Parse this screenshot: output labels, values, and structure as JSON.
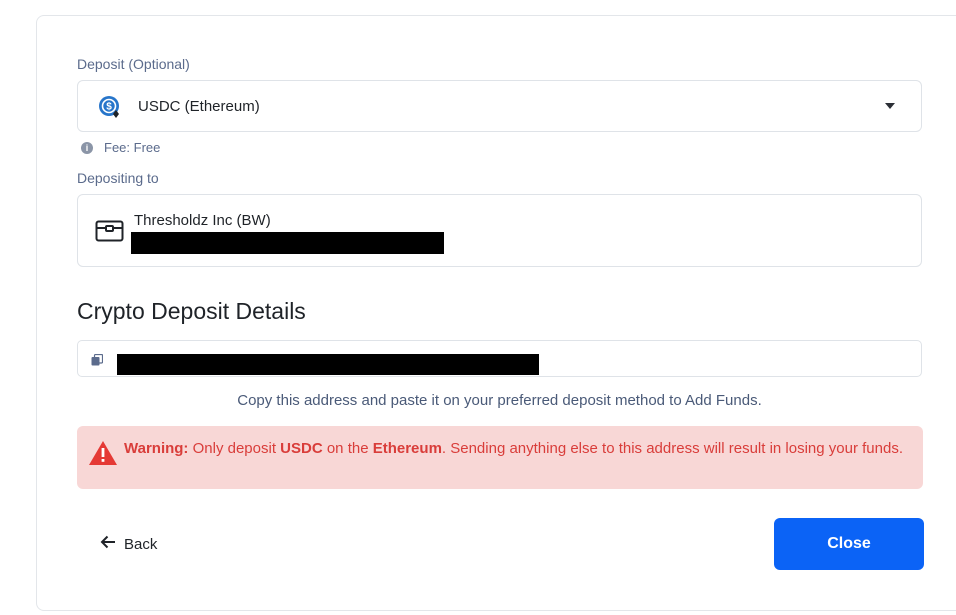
{
  "deposit": {
    "label": "Deposit (Optional)",
    "selected_asset": "USDC (Ethereum)",
    "fee_text": "Fee: Free"
  },
  "destination": {
    "label": "Depositing to",
    "account_name": "Thresholdz Inc (BW)"
  },
  "crypto_details": {
    "title": "Crypto Deposit Details",
    "helper_text": "Copy this address and paste it on your preferred deposit method to Add Funds."
  },
  "warning": {
    "prefix": "Warning:",
    "text1": " Only deposit ",
    "asset": "USDC",
    "text2": " on the ",
    "network": "Ethereum",
    "text3": ". Sending anything else to this address will result in losing your funds."
  },
  "actions": {
    "back_label": "Back",
    "close_label": "Close"
  },
  "colors": {
    "primary": "#0b63f6",
    "warning_bg": "#f8d7d6",
    "warning_text": "#d93d3a",
    "label": "#5b6b8c"
  },
  "icons": {
    "asset": "usdc-coin-icon",
    "info": "info-icon",
    "account": "wallet-icon",
    "copy": "copy-icon",
    "warning": "warning-triangle-icon",
    "back": "arrow-left-icon",
    "caret": "chevron-down-icon"
  }
}
